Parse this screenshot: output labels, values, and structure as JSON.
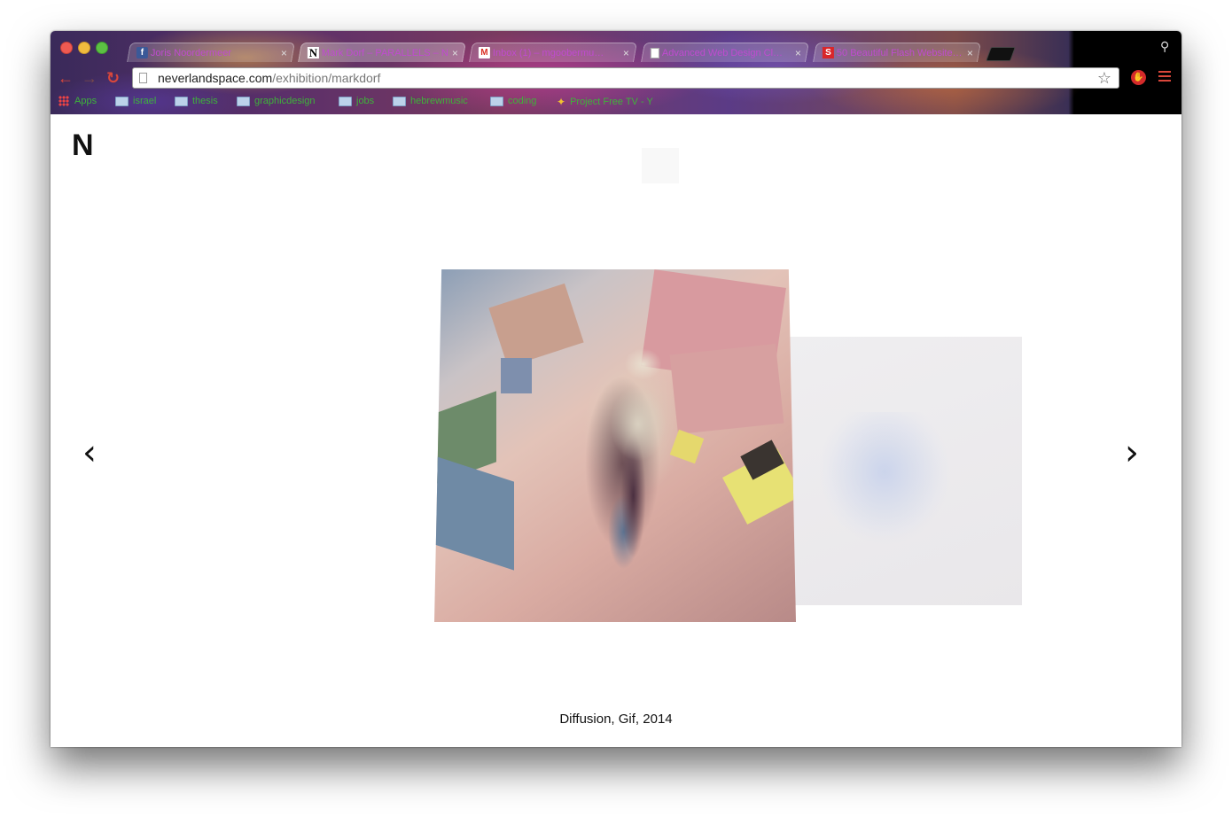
{
  "browser": {
    "tabs": [
      {
        "title": "Joris Noordermeer",
        "favicon": "facebook-favicon",
        "active": false
      },
      {
        "title": "Mark Dorf – PARALLELS – N",
        "favicon": "n-favicon",
        "active": true
      },
      {
        "title": "Inbox (1) – mgoobermu…",
        "favicon": "gmail-favicon",
        "active": false
      },
      {
        "title": "Advanced Web Design Cl…",
        "favicon": "document-favicon",
        "active": false
      },
      {
        "title": "50 Beautiful Flash Website…",
        "favicon": "s-favicon",
        "active": false
      }
    ],
    "tab_close": "×",
    "omnibox": {
      "domain": "neverlandspace.com",
      "path": "/exhibition/markdorf"
    },
    "bookmarks": [
      {
        "label": "Apps",
        "icon": "apps-grid-icon"
      },
      {
        "label": "israel",
        "icon": "folder-icon"
      },
      {
        "label": "thesis",
        "icon": "folder-icon"
      },
      {
        "label": "graphicdesign",
        "icon": "folder-icon"
      },
      {
        "label": "jobs",
        "icon": "folder-icon"
      },
      {
        "label": "hebrewmusic",
        "icon": "folder-icon"
      },
      {
        "label": "coding",
        "icon": "folder-icon"
      },
      {
        "label": "Project Free TV - Y",
        "icon": "project-free-tv-icon"
      }
    ]
  },
  "page": {
    "logo": "N",
    "nav_prev": "‹",
    "nav_next": "›",
    "caption": "Diffusion, Gif, 2014"
  },
  "colors": {
    "bookmark_text": "#3eb33a",
    "tab_text": "#c04bd0",
    "accent_red": "#d9473b"
  }
}
